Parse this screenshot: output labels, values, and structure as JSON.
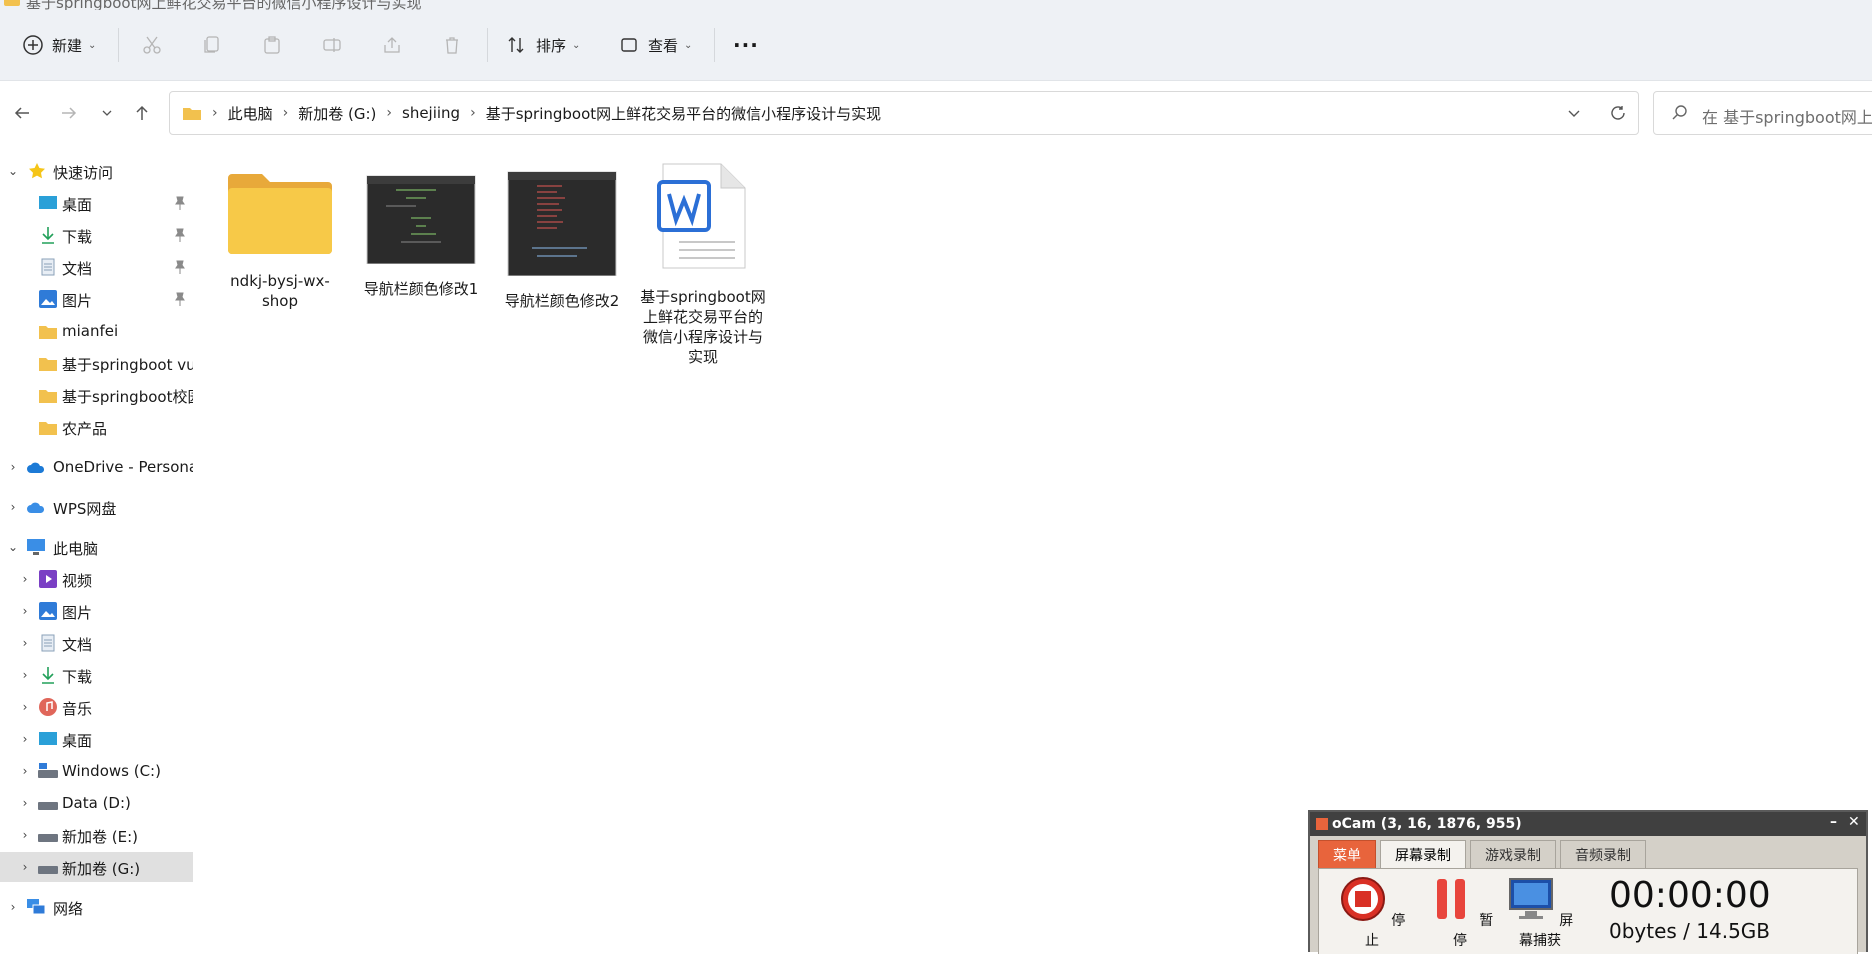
{
  "window": {
    "title": "基于springboot网上鲜花交易平台的微信小程序设计与实现"
  },
  "toolbar": {
    "new_label": "新建",
    "sort_label": "排序",
    "view_label": "查看",
    "more_label": "···"
  },
  "breadcrumb": [
    "此电脑",
    "新加卷 (G:)",
    "shejiing",
    "基于springboot网上鲜花交易平台的微信小程序设计与实现"
  ],
  "search": {
    "placeholder": "在 基于springboot网上鲜花交易平台的微信小程序设计与实现 中搜索"
  },
  "sidebar": {
    "quick_access": "快速访问",
    "quick_items": [
      "桌面",
      "下载",
      "文档",
      "图片",
      "mianfei",
      "基于springboot vue",
      "基于springboot校园",
      "农产品"
    ],
    "onedrive": "OneDrive - Personal",
    "wps": "WPS网盘",
    "this_pc": "此电脑",
    "pc_items": [
      "视频",
      "图片",
      "文档",
      "下载",
      "音乐",
      "桌面",
      "Windows (C:)",
      "Data (D:)",
      "新加卷 (E:)",
      "新加卷 (G:)"
    ],
    "network": "网络"
  },
  "files": [
    {
      "name": "ndkj-bysj-wx-shop",
      "type": "folder"
    },
    {
      "name": "导航栏颜色修改1",
      "type": "image"
    },
    {
      "name": "导航栏颜色修改2",
      "type": "image"
    },
    {
      "name": "基于springboot网上鲜花交易平台的微信小程序设计与实现",
      "type": "word"
    }
  ],
  "ocam": {
    "title": "oCam (3, 16, 1876, 955)",
    "tabs": [
      "菜单",
      "屏幕录制",
      "游戏录制",
      "音频录制"
    ],
    "stop_label": "停止",
    "pause_label": "暂停",
    "capture_label": "屏幕捕获",
    "timer": "00:00:00",
    "size": "0bytes / 14.5GB"
  },
  "colors": {
    "accent": "#1a73e8",
    "folder": "#f2c14e",
    "ocam_menu": "#e8643c",
    "selected": "#e0e0e0"
  }
}
